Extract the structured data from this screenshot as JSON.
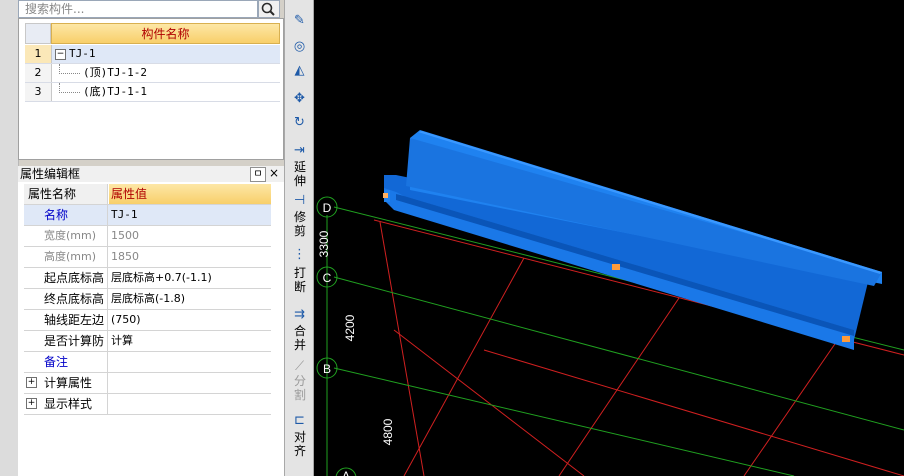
{
  "search": {
    "placeholder": "搜索构件..."
  },
  "tree": {
    "header": "构件名称",
    "rows": [
      {
        "num": "1",
        "label": "TJ-1"
      },
      {
        "num": "2",
        "label": "(顶)TJ-1-2"
      },
      {
        "num": "3",
        "label": "(底)TJ-1-1"
      }
    ]
  },
  "props": {
    "title": "属性编辑框",
    "pin": "ㅁ",
    "close": "×",
    "header_name": "属性名称",
    "header_value": "属性值",
    "rows": [
      {
        "name": "名称",
        "value": "TJ-1"
      },
      {
        "name": "宽度(mm)",
        "value": "1500"
      },
      {
        "name": "高度(mm)",
        "value": "1850"
      },
      {
        "name": "起点底标高",
        "value": "层底标高+0.7(-1.1)"
      },
      {
        "name": "终点底标高",
        "value": "层底标高(-1.8)"
      },
      {
        "name": "轴线距左边",
        "value": "(750)"
      },
      {
        "name": "是否计算防",
        "value": "计算"
      },
      {
        "name": "备注",
        "value": ""
      },
      {
        "name": "计算属性",
        "value": ""
      },
      {
        "name": "显示样式",
        "value": ""
      }
    ]
  },
  "toolbar": {
    "extend": "延伸",
    "trim": "修剪",
    "break": "打断",
    "merge": "合并",
    "split": "分割",
    "align": "对齐"
  },
  "viewport": {
    "axes": [
      "D",
      "C",
      "B",
      "A"
    ],
    "dims": [
      "3300",
      "4200",
      "4800"
    ]
  }
}
